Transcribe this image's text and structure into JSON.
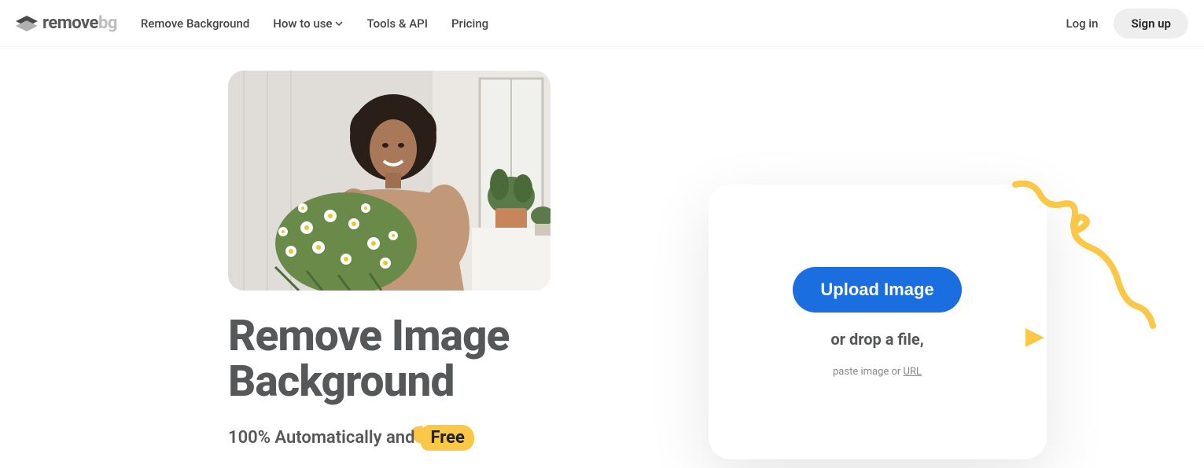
{
  "header": {
    "logo_text1": "remove",
    "logo_text2": "bg",
    "nav": {
      "remove_bg": "Remove Background",
      "how_to_use": "How to use",
      "tools_api": "Tools & API",
      "pricing": "Pricing"
    },
    "login": "Log in",
    "signup": "Sign up"
  },
  "hero": {
    "title_line1": "Remove Image",
    "title_line2": "Background",
    "subtitle_prefix": "100% Automatically and",
    "free_label": "Free"
  },
  "upload": {
    "button": "Upload Image",
    "drop_text": "or drop a file,",
    "paste_prefix": "paste image or ",
    "url_label": "URL"
  }
}
